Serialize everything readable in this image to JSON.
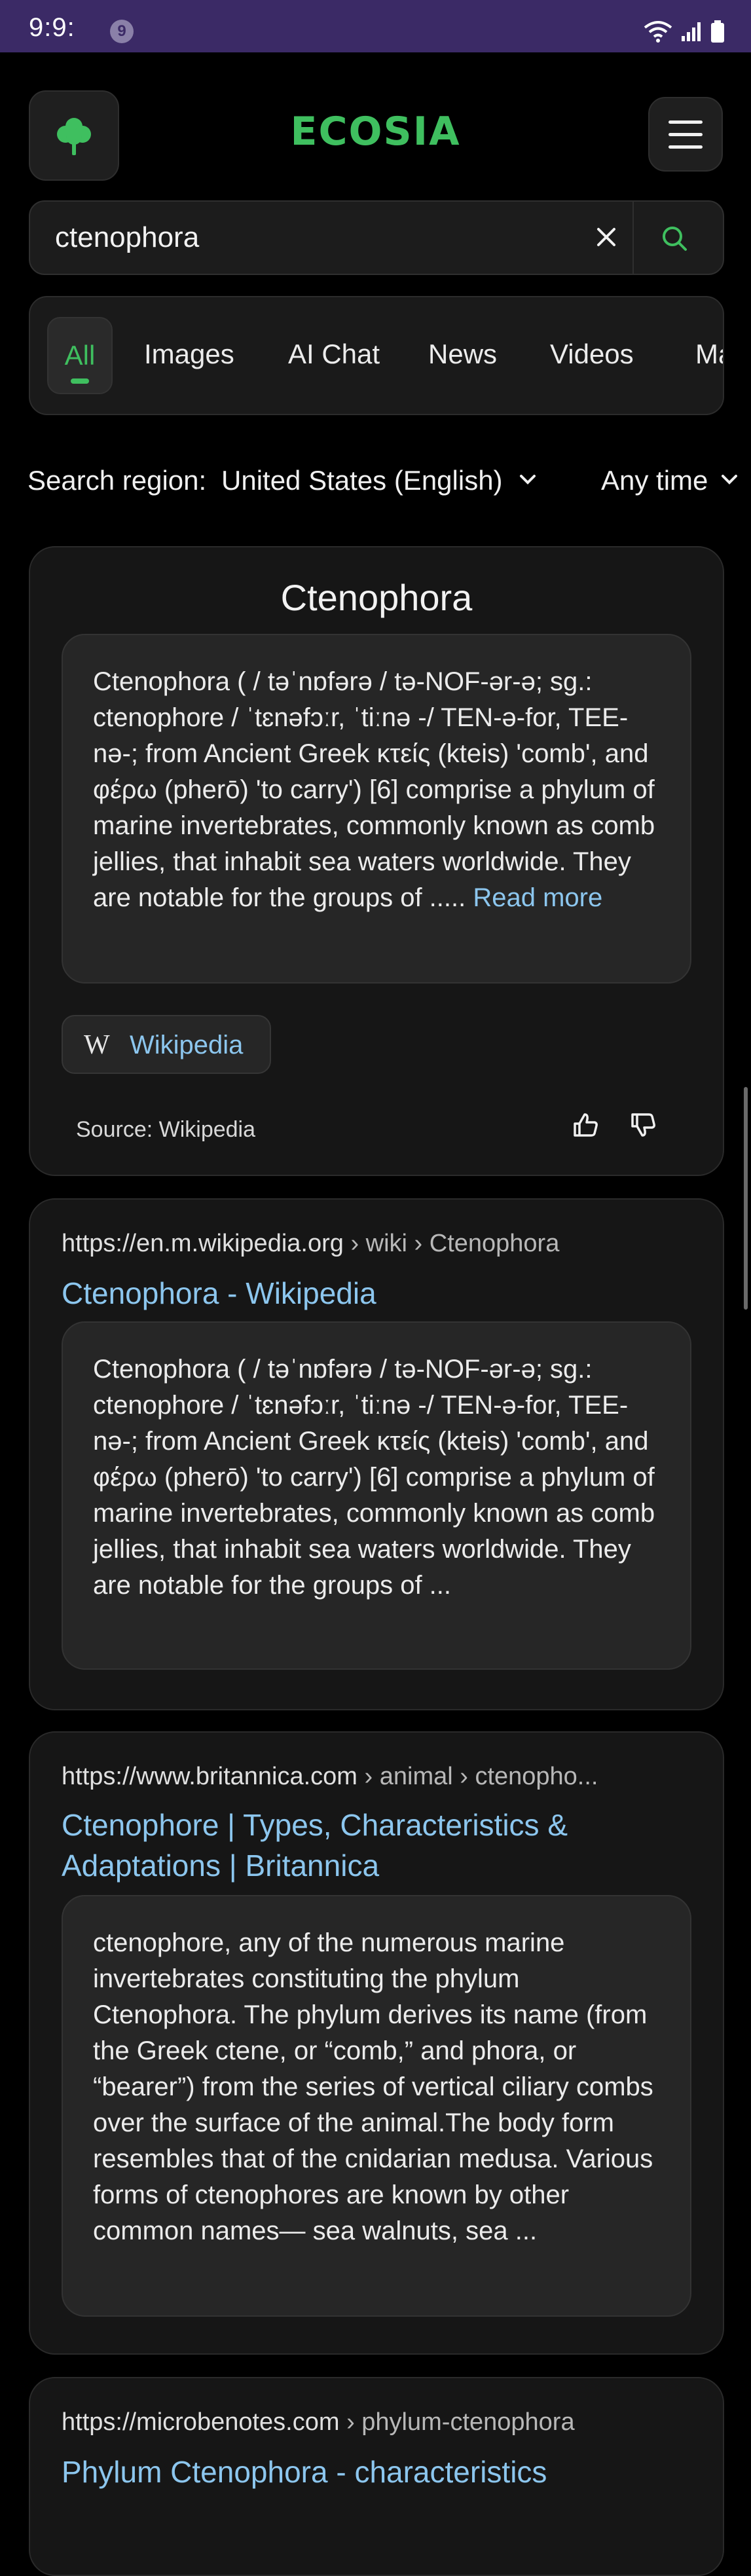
{
  "status_bar": {
    "time": "9:9:",
    "notification_count": "9"
  },
  "header": {
    "brand": "ECOSIA"
  },
  "search": {
    "query": "ctenophora"
  },
  "tabs": [
    {
      "label": "All"
    },
    {
      "label": "Images"
    },
    {
      "label": "AI Chat"
    },
    {
      "label": "News"
    },
    {
      "label": "Videos"
    },
    {
      "label": "Ma"
    }
  ],
  "filters": {
    "region_label": "Search region:",
    "region_value": "United States (English)",
    "time_value": "Any time"
  },
  "knowledge_panel": {
    "title": "Ctenophora",
    "snippet": "Ctenophora ( / təˈnɒfərə / tə-NOF-ər-ə; sg.: ctenophore / ˈtɛnəfɔːr, ˈtiːnə -/ TEN-ə-for, TEE-nə-; from Ancient Greek κτείς (kteis) 'comb', and φέρω (pherō) 'to carry') [6] comprise a phylum of marine invertebrates, commonly known as comb jellies, that inhabit sea waters worldwide. They are notable for the groups of .....",
    "read_more": "Read more",
    "wiki_icon": "W",
    "wiki_label": "Wikipedia",
    "source": "Source: Wikipedia"
  },
  "results": [
    {
      "url_host": "https://en.m.wikipedia.org",
      "url_path": " › wiki › Ctenophora",
      "title": "Ctenophora - Wikipedia",
      "snippet": "Ctenophora ( / təˈnɒfərə / tə-NOF-ər-ə; sg.: ctenophore / ˈtɛnəfɔːr, ˈtiːnə -/ TEN-ə-for, TEE-nə-; from Ancient Greek κτείς (kteis) 'comb', and φέρω (pherō) 'to carry') [6] comprise a phylum of marine invertebrates, commonly known as comb jellies, that inhabit sea waters worldwide. They are notable for the groups of ..."
    },
    {
      "url_host": "https://www.britannica.com",
      "url_path": " › animal › ctenopho...",
      "title": "Ctenophore | Types, Characteristics & Adaptations | Britannica",
      "snippet": "ctenophore, any of the numerous marine invertebrates constituting the phylum Ctenophora. The phylum derives its name (from the Greek ctene, or “comb,” and phora, or “bearer”) from the series of vertical ciliary combs over the surface of the animal.The body form resembles that of the cnidarian medusa. Various forms of ctenophores are known by other common names— sea walnuts, sea ..."
    },
    {
      "url_host": "https://microbenotes.com",
      "url_path": " › phylum-ctenophora",
      "title": "Phylum Ctenophora - characteristics"
    }
  ],
  "colors": {
    "accent": "#3fbf5f",
    "link": "#8cc6ee",
    "status_bar": "#3b2a66"
  }
}
